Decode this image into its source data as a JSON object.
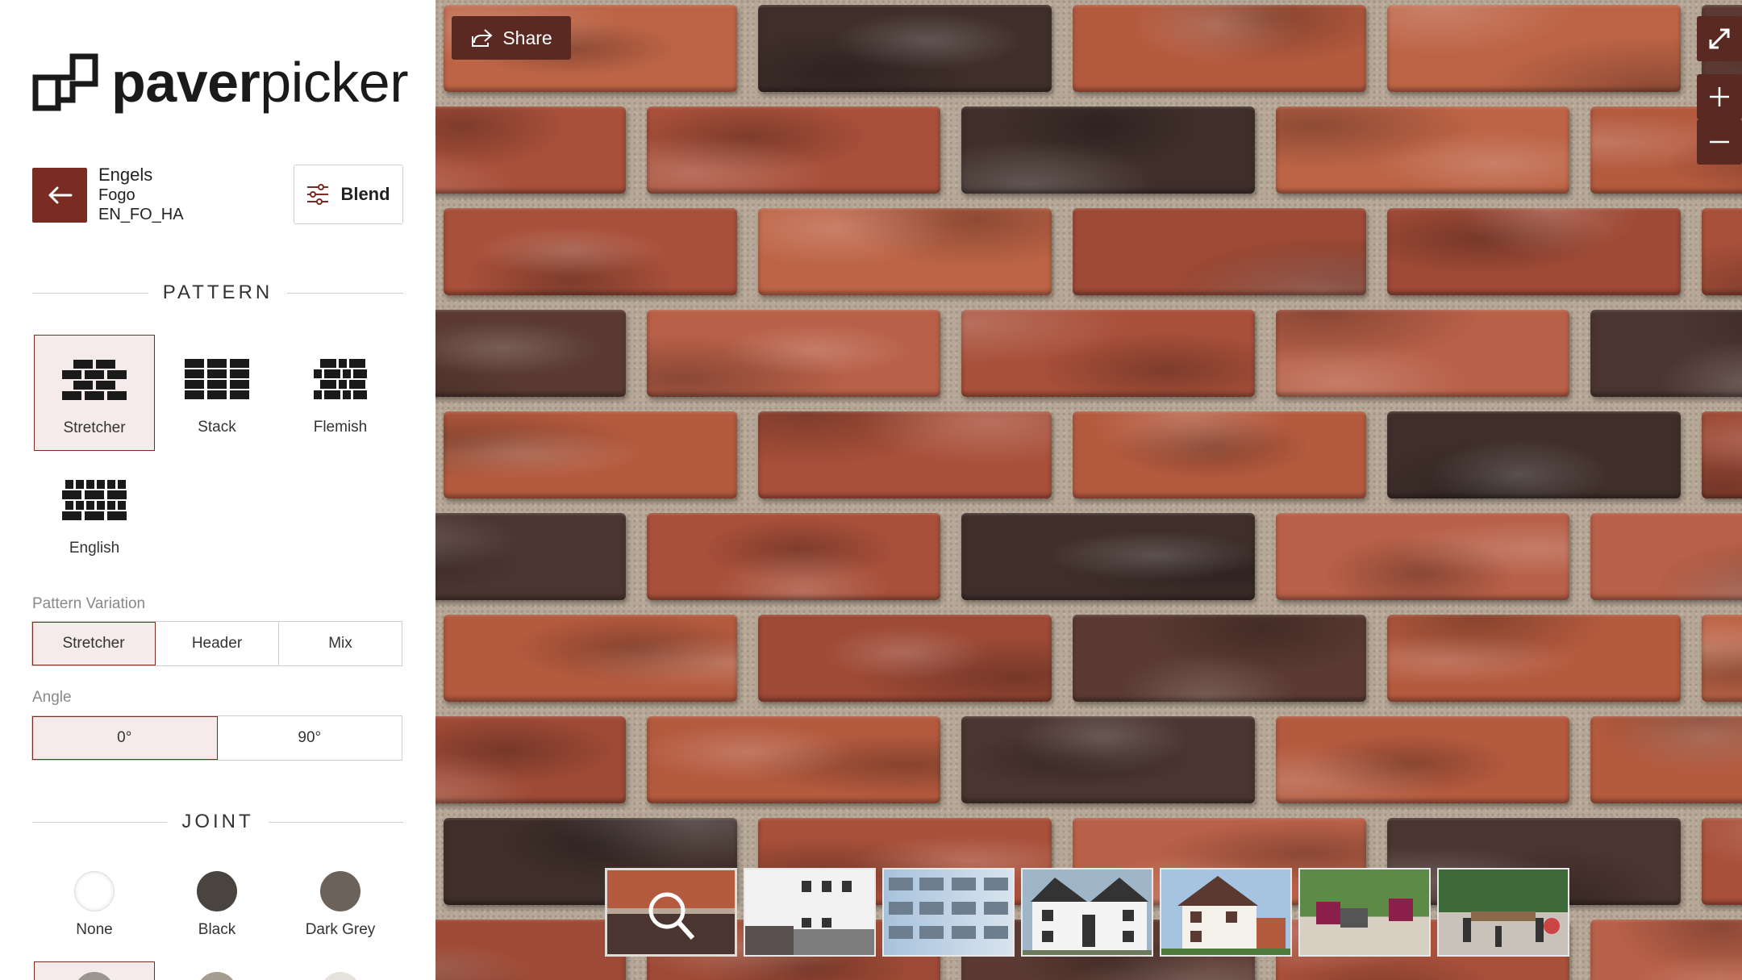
{
  "brand": {
    "name_part1": "paver",
    "name_part2": "picker"
  },
  "product": {
    "name": "Engels",
    "color": "Fogo",
    "code": "EN_FO_HA"
  },
  "buttons": {
    "blend": "Blend",
    "share": "Share"
  },
  "sections": {
    "pattern": "PATTERN",
    "joint": "JOINT"
  },
  "patterns": [
    {
      "label": "Stretcher",
      "selected": true
    },
    {
      "label": "Stack",
      "selected": false
    },
    {
      "label": "Flemish",
      "selected": false
    },
    {
      "label": "English",
      "selected": false
    }
  ],
  "pattern_variation": {
    "label": "Pattern Variation",
    "options": [
      "Stretcher",
      "Header",
      "Mix"
    ],
    "selected": "Stretcher"
  },
  "angle": {
    "label": "Angle",
    "options": [
      "0°",
      "90°"
    ],
    "selected": "0°"
  },
  "joints": [
    {
      "label": "None",
      "color": "#ffffff"
    },
    {
      "label": "Black",
      "color": "#4a4440"
    },
    {
      "label": "Dark Grey",
      "color": "#6b625c"
    }
  ],
  "colors": {
    "accent": "#7a2c22",
    "selected_bg": "#f4ebea",
    "preview_control": "#5a2a22",
    "mortar": "#b6a796",
    "brick_red": "#b45a3e",
    "brick_dark": "#4a3530"
  },
  "icons": {
    "back": "arrow-left-icon",
    "blend": "sliders-icon",
    "share": "share-icon",
    "fullscreen": "expand-icon",
    "zoom_in": "plus-icon",
    "zoom_out": "minus-icon"
  },
  "scene_thumbnails": [
    "close-up",
    "modern-facade",
    "apartment-building",
    "white-house",
    "tudor-house",
    "patio-seating",
    "patio-dining"
  ]
}
